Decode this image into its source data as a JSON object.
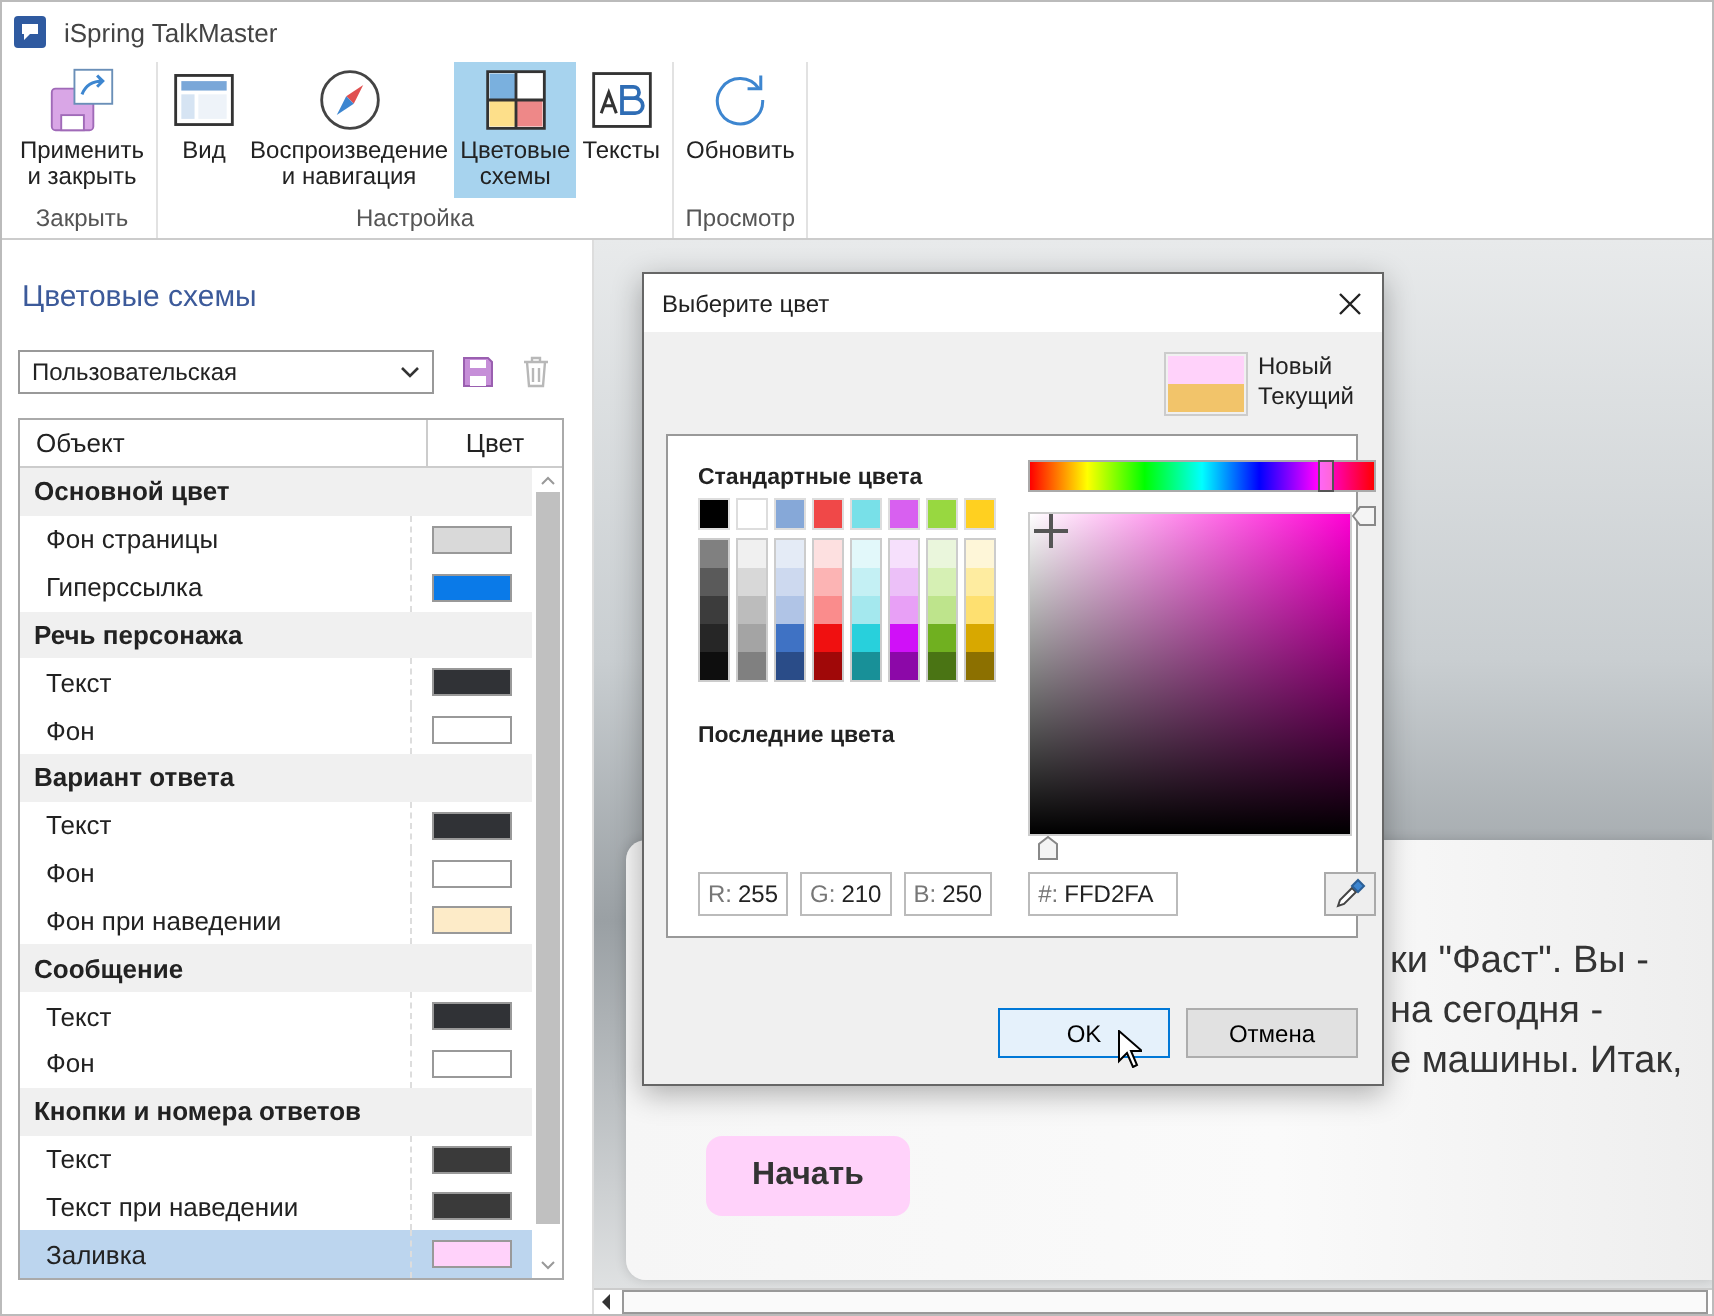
{
  "window": {
    "title": "iSpring TalkMaster"
  },
  "ribbon": {
    "groups": [
      {
        "label": "Закрыть",
        "buttons": [
          {
            "kind": "apply",
            "label": "Применить\nи закрыть",
            "selected": false
          }
        ]
      },
      {
        "label": "Настройка",
        "buttons": [
          {
            "kind": "view",
            "label": "Вид",
            "selected": false
          },
          {
            "kind": "playback",
            "label": "Воспроизведение\nи навигация",
            "selected": false
          },
          {
            "kind": "colors",
            "label": "Цветовые\nсхемы",
            "selected": true
          },
          {
            "kind": "texts",
            "label": "Тексты",
            "selected": false
          }
        ]
      },
      {
        "label": "Просмотр",
        "buttons": [
          {
            "kind": "refresh",
            "label": "Обновить",
            "selected": false
          }
        ]
      }
    ]
  },
  "sidebar": {
    "title": "Цветовые схемы",
    "scheme_select": {
      "value": "Пользовательская"
    },
    "table": {
      "columns": [
        "Объект",
        "Цвет"
      ],
      "groups": [
        {
          "label": "Основной цвет",
          "children": [
            {
              "label": "Фон страницы",
              "color": "#d9d9d9",
              "selected": false
            },
            {
              "label": "Гиперссылка",
              "color": "#0a7ae8",
              "selected": false
            }
          ]
        },
        {
          "label": "Речь персонажа",
          "children": [
            {
              "label": "Текст",
              "color": "#303236",
              "selected": false
            },
            {
              "label": "Фон",
              "color": "#ffffff",
              "selected": false
            }
          ]
        },
        {
          "label": "Вариант ответа",
          "children": [
            {
              "label": "Текст",
              "color": "#303236",
              "selected": false
            },
            {
              "label": "Фон",
              "color": "#ffffff",
              "selected": false
            },
            {
              "label": "Фон при наведении",
              "color": "#fdebc8",
              "selected": false
            }
          ]
        },
        {
          "label": "Сообщение",
          "children": [
            {
              "label": "Текст",
              "color": "#303236",
              "selected": false
            },
            {
              "label": "Фон",
              "color": "#ffffff",
              "selected": false
            }
          ]
        },
        {
          "label": "Кнопки и номера ответов",
          "children": [
            {
              "label": "Текст",
              "color": "#3a3a3a",
              "selected": false
            },
            {
              "label": "Текст при наведении",
              "color": "#3a3a3a",
              "selected": false
            },
            {
              "label": "Заливка",
              "color": "#ffd2fa",
              "selected": true
            }
          ]
        }
      ]
    }
  },
  "preview": {
    "speech_lines": [
      "ки \"Фаст\". Вы -",
      "на сегодня -",
      "е машины. Итак,"
    ],
    "start_button": {
      "label": "Начать",
      "color": "#ffd2fa"
    }
  },
  "color_dialog": {
    "title": "Выберите цвет",
    "new_color": {
      "label": "Новый",
      "color": "#ffd2fa"
    },
    "current_color": {
      "label": "Текущий",
      "color": "#f2c46a"
    },
    "standard_title": "Стандартные цвета",
    "standard_colors": [
      {
        "color": "#000000"
      },
      {
        "color": "#ffffff"
      },
      {
        "color": "#86a8d8"
      },
      {
        "color": "#f04848"
      },
      {
        "color": "#78e0e8"
      },
      {
        "color": "#d860f0"
      },
      {
        "color": "#98d840"
      },
      {
        "color": "#ffd020"
      }
    ],
    "shade_columns": [
      {
        "shades": [
          {
            "color": "#808080"
          },
          {
            "color": "#5a5a5a"
          },
          {
            "color": "#3c3c3c"
          },
          {
            "color": "#262626"
          },
          {
            "color": "#0e0e0e"
          }
        ]
      },
      {
        "shades": [
          {
            "color": "#f0f0f0"
          },
          {
            "color": "#d8d8d8"
          },
          {
            "color": "#bcbcbc"
          },
          {
            "color": "#a4a4a4"
          },
          {
            "color": "#808080"
          }
        ]
      },
      {
        "shades": [
          {
            "color": "#e4ebf6"
          },
          {
            "color": "#cdd9ef"
          },
          {
            "color": "#b0c4e6"
          },
          {
            "color": "#3f72c4"
          },
          {
            "color": "#2a4c88"
          }
        ]
      },
      {
        "shades": [
          {
            "color": "#fde0e0"
          },
          {
            "color": "#fcb4b4"
          },
          {
            "color": "#fa8c8c"
          },
          {
            "color": "#f01010"
          },
          {
            "color": "#a00808"
          }
        ]
      },
      {
        "shades": [
          {
            "color": "#e2f8fa"
          },
          {
            "color": "#c4f0f4"
          },
          {
            "color": "#a4e8ee"
          },
          {
            "color": "#28d0dc"
          },
          {
            "color": "#189098"
          }
        ]
      },
      {
        "shades": [
          {
            "color": "#f6e0fc"
          },
          {
            "color": "#ecc0f8"
          },
          {
            "color": "#e8a0f6"
          },
          {
            "color": "#d010f8"
          },
          {
            "color": "#8c08a8"
          }
        ]
      },
      {
        "shades": [
          {
            "color": "#eaf6dc"
          },
          {
            "color": "#d6f0b4"
          },
          {
            "color": "#bee48c"
          },
          {
            "color": "#70b020"
          },
          {
            "color": "#4a7414"
          }
        ]
      },
      {
        "shades": [
          {
            "color": "#fef6d8"
          },
          {
            "color": "#feeca0"
          },
          {
            "color": "#fee070"
          },
          {
            "color": "#d8a800"
          },
          {
            "color": "#8c7000"
          }
        ]
      }
    ],
    "recent_title": "Последние цвета",
    "hue_slider": {
      "level": 0.86
    },
    "horizontal_slider": {
      "level": 0.06
    },
    "vertical_slider": {
      "level": 0.99
    },
    "fields": [
      {
        "label": "R:",
        "value": "255"
      },
      {
        "label": "G:",
        "value": "210"
      },
      {
        "label": "B:",
        "value": "250"
      }
    ],
    "hex_field": {
      "label": "#:",
      "value": "FFD2FA"
    },
    "buttons": [
      {
        "label": "OK",
        "selected": true
      },
      {
        "label": "Отмена",
        "selected": false
      }
    ]
  }
}
